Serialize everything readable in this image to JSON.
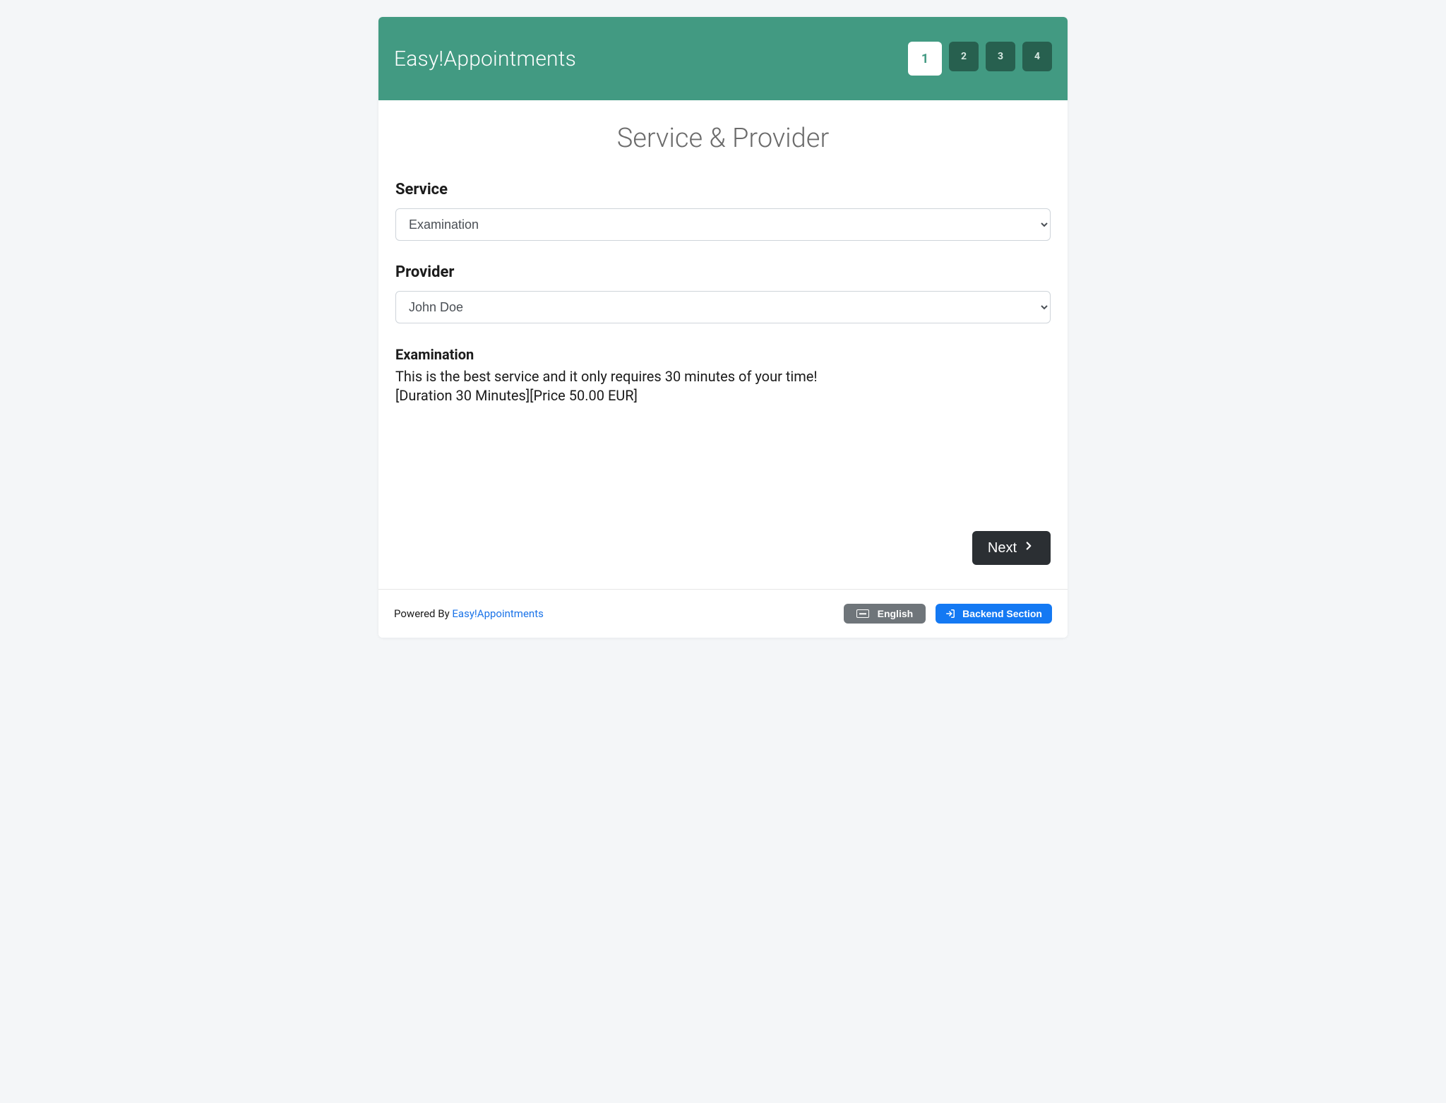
{
  "header": {
    "brand": "Easy!Appointments",
    "steps": [
      "1",
      "2",
      "3",
      "4"
    ],
    "active_step_index": 0
  },
  "main": {
    "title": "Service & Provider",
    "service": {
      "label": "Service",
      "selected": "Examination"
    },
    "provider": {
      "label": "Provider",
      "selected": "John Doe"
    },
    "description": {
      "title": "Examination",
      "text": "This is the best service and it only requires 30 minutes of your time!",
      "meta": "[Duration 30 Minutes][Price 50.00 EUR]"
    },
    "next_label": "Next"
  },
  "footer": {
    "powered_by_prefix": "Powered By ",
    "powered_by_link": "Easy!Appointments",
    "language_label": "English",
    "backend_label": "Backend Section"
  }
}
